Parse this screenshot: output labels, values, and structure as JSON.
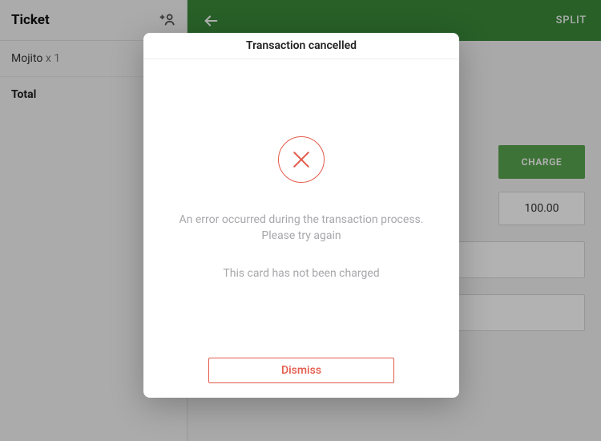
{
  "left": {
    "title": "Ticket",
    "line_item": {
      "name": "Mojito",
      "qty": "x 1"
    },
    "total_label": "Total"
  },
  "topbar": {
    "split_label": "SPLIT"
  },
  "payment": {
    "charge_label": "CHARGE",
    "amount": "100.00"
  },
  "modal": {
    "title": "Transaction cancelled",
    "message1": "An error occurred during the transaction process. Please try again",
    "message2": "This card has not been charged",
    "dismiss_label": "Dismiss"
  }
}
